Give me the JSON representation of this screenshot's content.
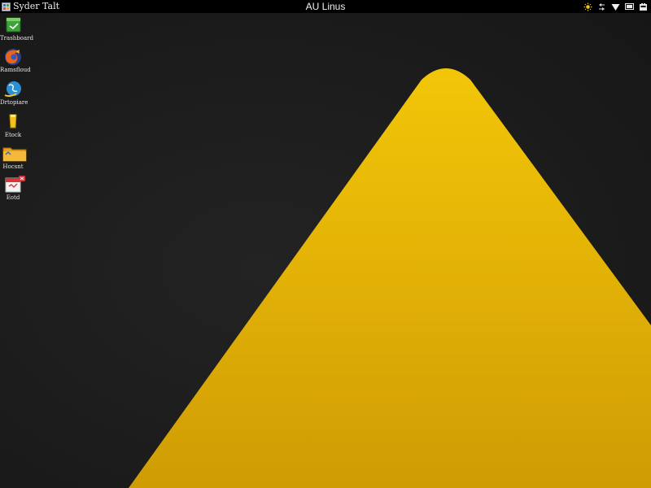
{
  "panel": {
    "app_label": "Syder Talt",
    "center_title": "AU Linus",
    "app_menu_icon": "app-grid-icon",
    "tray": [
      {
        "name": "brightness-icon"
      },
      {
        "name": "network-icon"
      },
      {
        "name": "wifi-icon"
      },
      {
        "name": "display-icon"
      },
      {
        "name": "battery-icon"
      }
    ]
  },
  "desktop_icons": [
    {
      "label": "Trashboard",
      "icon": "green-document-icon"
    },
    {
      "label": "Ramsfloud",
      "icon": "firefox-icon"
    },
    {
      "label": "Drtopiare",
      "icon": "browser-globe-icon"
    },
    {
      "label": "Etock",
      "icon": "glass-icon"
    },
    {
      "label": "Hocsnt",
      "icon": "folder-icon"
    },
    {
      "label": "Eotd",
      "icon": "red-document-icon"
    }
  ],
  "colors": {
    "background": "#1c1c1c",
    "triangle_top": "#f1c40a",
    "triangle_bottom": "#d09e04",
    "panel": "#000000"
  }
}
